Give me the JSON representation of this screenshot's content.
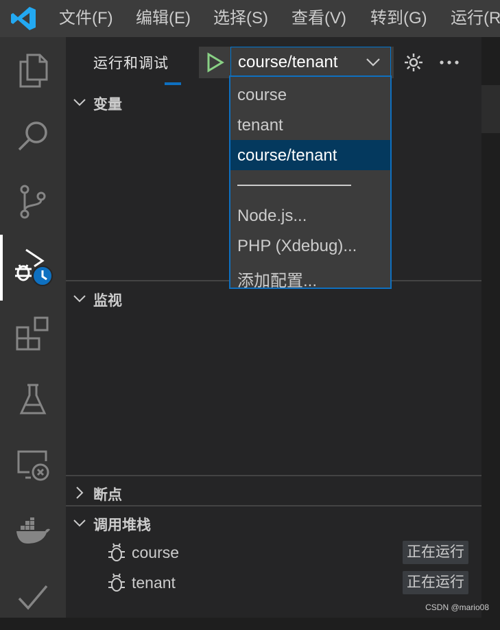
{
  "menubar": {
    "items": [
      "文件(F)",
      "编辑(E)",
      "选择(S)",
      "查看(V)",
      "转到(G)",
      "运行(R"
    ]
  },
  "activity_bar": {
    "icons": [
      "explorer-icon",
      "search-icon",
      "source-control-icon",
      "run-debug-icon",
      "extensions-icon",
      "testing-icon",
      "remote-explorer-icon",
      "docker-icon",
      "todo-check-icon"
    ],
    "active": "run-debug-icon"
  },
  "sidebar": {
    "title": "运行和调试",
    "selected_config": "course/tenant",
    "sections": {
      "variables": "变量",
      "watch": "监视",
      "breakpoints": "断点",
      "call_stack": "调用堆栈"
    },
    "call_stack": [
      {
        "name": "course",
        "status": "正在运行"
      },
      {
        "name": "tenant",
        "status": "正在运行"
      }
    ]
  },
  "dropdown": {
    "options": [
      "course",
      "tenant",
      "course/tenant"
    ],
    "selected": "course/tenant",
    "separator": "──────────",
    "extra_options": [
      "Node.js...",
      "PHP (Xdebug)...",
      "添加配置..."
    ]
  },
  "watermark": "CSDN @mario08",
  "colors": {
    "accent": "#0e70c0",
    "selection": "#04395e",
    "play_green": "#89d185",
    "vscode_blue": "#23a9f2"
  }
}
